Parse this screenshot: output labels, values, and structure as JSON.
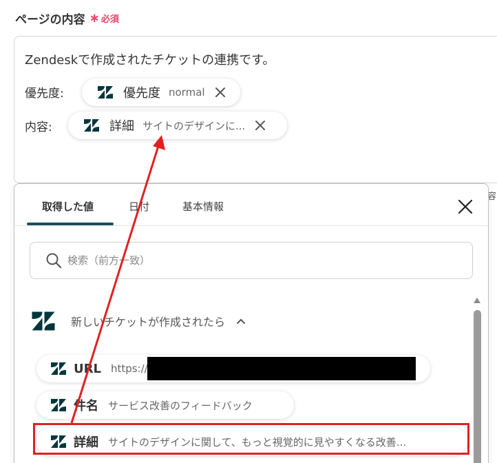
{
  "field": {
    "label": "ページの内容",
    "required_mark": "∗",
    "required_text": "必須"
  },
  "editor": {
    "line1": "Zendeskで作成されたチケットの連携です。",
    "priority_label": "優先度:",
    "priority_chip": {
      "name": "優先度",
      "value": "normal"
    },
    "content_label": "内容:",
    "content_chip": {
      "name": "詳細",
      "value": "サイトのデザインに..."
    }
  },
  "side_fragment": "容",
  "panel": {
    "tabs": [
      {
        "label": "取得した値",
        "active": true
      },
      {
        "label": "日付",
        "active": false
      },
      {
        "label": "基本情報",
        "active": false
      }
    ],
    "search_placeholder": "検索（前方一致）",
    "group": {
      "title": "新しいチケットが作成されたら"
    },
    "items": [
      {
        "name": "URL",
        "value": "https://"
      },
      {
        "name": "件名",
        "value": "サービス改善のフィードバック"
      },
      {
        "name": "詳細",
        "value": "サイトのデザインに関して、もっと視覚的に見やすくなる改善..."
      }
    ]
  },
  "colors": {
    "required": "#e8456b",
    "tab_underline": "#1a4f5c",
    "zendesk_logo": "#03363d",
    "highlight": "#e02020"
  },
  "icons": {
    "chip_logo": "zendesk-logo-icon",
    "chip_remove": "close-icon",
    "panel_close": "close-icon",
    "search": "search-icon",
    "group_toggle": "chevron-up-icon"
  }
}
